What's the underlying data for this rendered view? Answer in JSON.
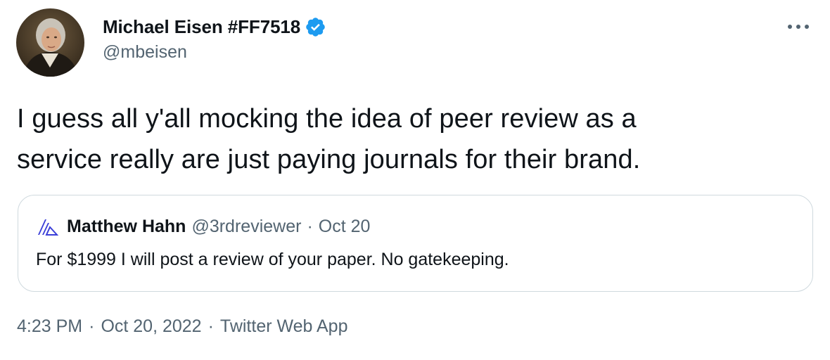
{
  "author": {
    "display_name": "Michael Eisen #FF7518",
    "handle": "@mbeisen",
    "verified": true,
    "avatar_icon": "portrait-avatar",
    "verified_color": "#1d9bf0"
  },
  "tweet": {
    "text_line1": "I guess all y'all mocking the idea of peer review as a",
    "text_line2": "service really are just paying journals for their brand."
  },
  "more_icon": "more-horizontal-icon",
  "quote": {
    "display_name": "Matthew Hahn",
    "handle": "@3rdreviewer",
    "separator": "·",
    "date": "Oct 20",
    "text": "For $1999 I will post a review of your paper. No gatekeeping.",
    "avatar_icon": "triangle-logo-avatar",
    "avatar_color": "#3b3fd8"
  },
  "meta": {
    "time": "4:23 PM",
    "separator": "·",
    "date": "Oct 20, 2022",
    "source": "Twitter Web App"
  }
}
